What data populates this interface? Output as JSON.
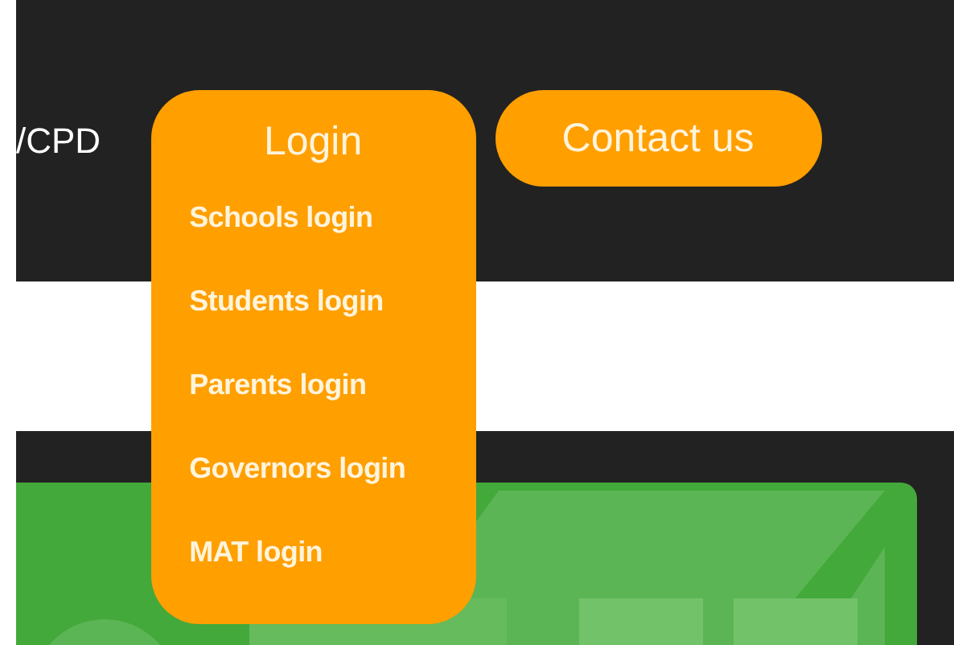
{
  "nav": {
    "partial_link": "/CPD",
    "login": {
      "label": "Login",
      "expanded": true,
      "items": [
        {
          "label": "Schools login"
        },
        {
          "label": "Students login"
        },
        {
          "label": "Parents login"
        },
        {
          "label": "Governors login"
        },
        {
          "label": "MAT login"
        }
      ]
    },
    "contact_button": "Contact us"
  }
}
